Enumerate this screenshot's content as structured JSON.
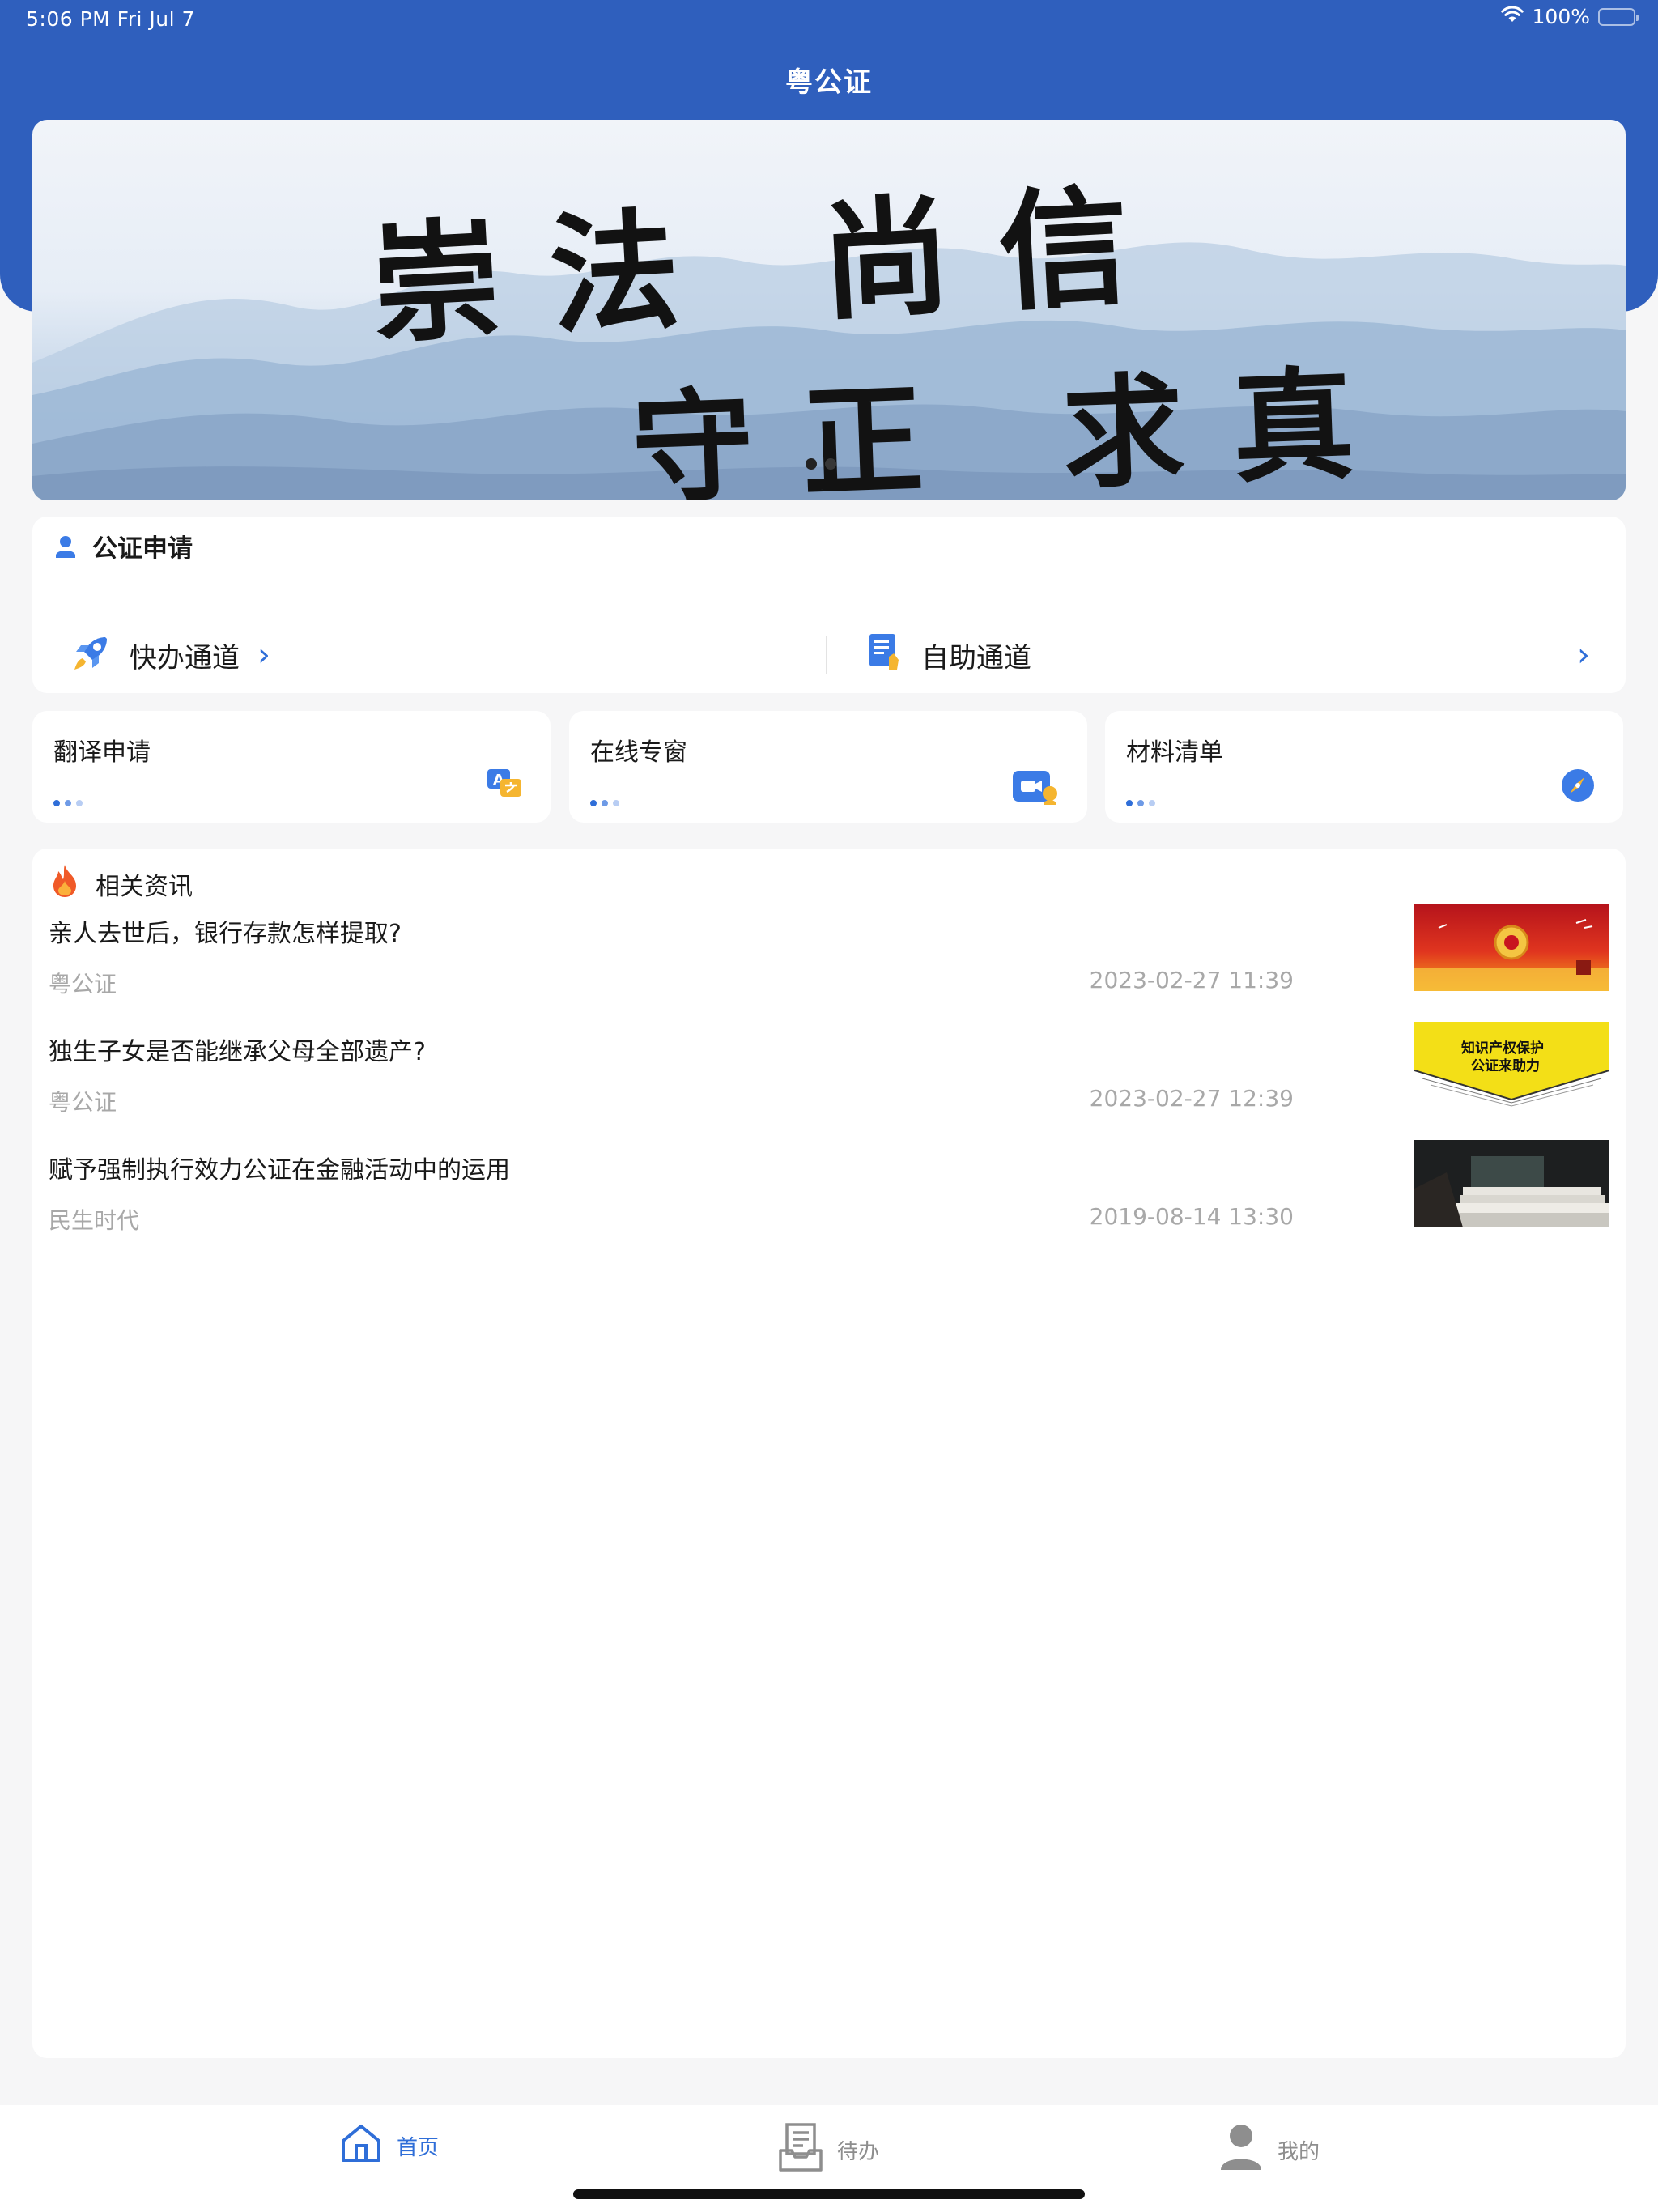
{
  "status_bar": {
    "time": "5:06 PM  Fri Jul 7",
    "battery": "100%"
  },
  "header": {
    "title": "粤公证"
  },
  "banner": {
    "line1": "崇法 尚信",
    "line2": "守正 求真",
    "page_count": 2,
    "active_page": 1
  },
  "apply": {
    "title": "公证申请",
    "fast_channel": "快办通道",
    "self_channel": "自助通道"
  },
  "services": [
    {
      "label": "翻译申请",
      "icon": "translate-icon"
    },
    {
      "label": "在线专窗",
      "icon": "video-call-icon"
    },
    {
      "label": "材料清单",
      "icon": "compass-icon"
    }
  ],
  "news": {
    "title": "相关资讯",
    "items": [
      {
        "title": "亲人去世后，银行存款怎样提取?",
        "source": "粤公证",
        "time": "2023-02-27 11:39"
      },
      {
        "title": "独生子女是否能继承父母全部遗产?",
        "source": "粤公证",
        "time": "2023-02-27 12:39",
        "thumb_text_1": "知识产权保护",
        "thumb_text_2": "公证来助力"
      },
      {
        "title": "赋予强制执行效力公证在金融活动中的运用",
        "source": "民生时代",
        "time": "2019-08-14 13:30"
      }
    ]
  },
  "tabs": {
    "home": "首页",
    "todo": "待办",
    "mine": "我的"
  },
  "colors": {
    "brand_blue": "#2f5fbd",
    "accent_blue": "#2f6ed8",
    "muted_text": "#a8a8a8"
  }
}
